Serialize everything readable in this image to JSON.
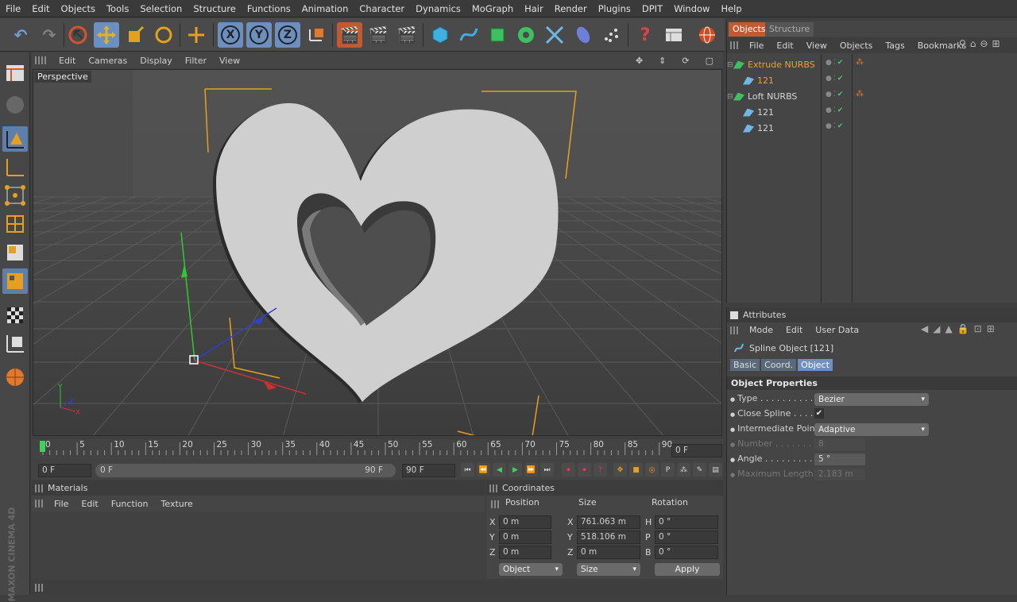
{
  "menu": [
    "File",
    "Edit",
    "Objects",
    "Tools",
    "Selection",
    "Structure",
    "Functions",
    "Animation",
    "Character",
    "Dynamics",
    "MoGraph",
    "Hair",
    "Render",
    "Plugins",
    "DPIT",
    "Window",
    "Help"
  ],
  "toolbar": {
    "x_label": "X",
    "y_label": "Y",
    "z_label": "Z"
  },
  "viewport": {
    "menu": [
      "Edit",
      "Cameras",
      "Display",
      "Filter",
      "View"
    ],
    "label": "Perspective"
  },
  "timeline": {
    "ticks": [
      "0",
      "5",
      "10",
      "15",
      "20",
      "25",
      "30",
      "35",
      "40",
      "45",
      "50",
      "55",
      "60",
      "65",
      "70",
      "75",
      "80",
      "85",
      "90"
    ],
    "current": "0 F"
  },
  "transport": {
    "start": "0 F",
    "slider_start": "0 F",
    "slider_end": "90 F",
    "end": "90 F"
  },
  "materials": {
    "title": "Materials",
    "menu": [
      "File",
      "Edit",
      "Function",
      "Texture"
    ]
  },
  "coords": {
    "title": "Coordinates",
    "headers": [
      "Position",
      "Size",
      "Rotation"
    ],
    "rows": [
      {
        "axis": "X",
        "pos": "0 m",
        "saxis": "X",
        "size": "761.063 m",
        "raxis": "H",
        "rot": "0 °"
      },
      {
        "axis": "Y",
        "pos": "0 m",
        "saxis": "Y",
        "size": "518.106 m",
        "raxis": "P",
        "rot": "0 °"
      },
      {
        "axis": "Z",
        "pos": "0 m",
        "saxis": "Z",
        "size": "0 m",
        "raxis": "B",
        "rot": "0 °"
      }
    ],
    "mode1": "Object",
    "mode2": "Size",
    "apply": "Apply"
  },
  "objects": {
    "tabs": [
      "Objects",
      "Structure"
    ],
    "menu": [
      "File",
      "Edit",
      "View",
      "Objects",
      "Tags",
      "Bookmarks"
    ],
    "items": [
      {
        "name": "Extrude NURBS",
        "color": "#e8a23a"
      },
      {
        "name": "121",
        "color": "#e8a23a"
      },
      {
        "name": "Loft NURBS",
        "color": "#d6d6d6"
      },
      {
        "name": "121",
        "color": "#d6d6d6"
      },
      {
        "name": "121",
        "color": "#d6d6d6"
      }
    ]
  },
  "attributes": {
    "title": "Attributes",
    "menu": [
      "Mode",
      "Edit",
      "User Data"
    ],
    "object": "Spline Object [121]",
    "tabs": [
      "Basic",
      "Coord.",
      "Object"
    ],
    "section": "Object Properties",
    "props": [
      {
        "label": "Type . . . . . . . . . . .",
        "value": "Bezier"
      },
      {
        "label": "Close Spline . . . . .",
        "value": "✔"
      },
      {
        "label": "Intermediate Points",
        "value": "Adaptive"
      },
      {
        "label": "Number . . . . . . . .",
        "value": "8"
      },
      {
        "label": "Angle . . . . . . . . . .",
        "value": "5 °"
      },
      {
        "label": "Maximum Length",
        "value": "2.183 m"
      }
    ]
  },
  "brand": "MAXON CINEMA 4D"
}
